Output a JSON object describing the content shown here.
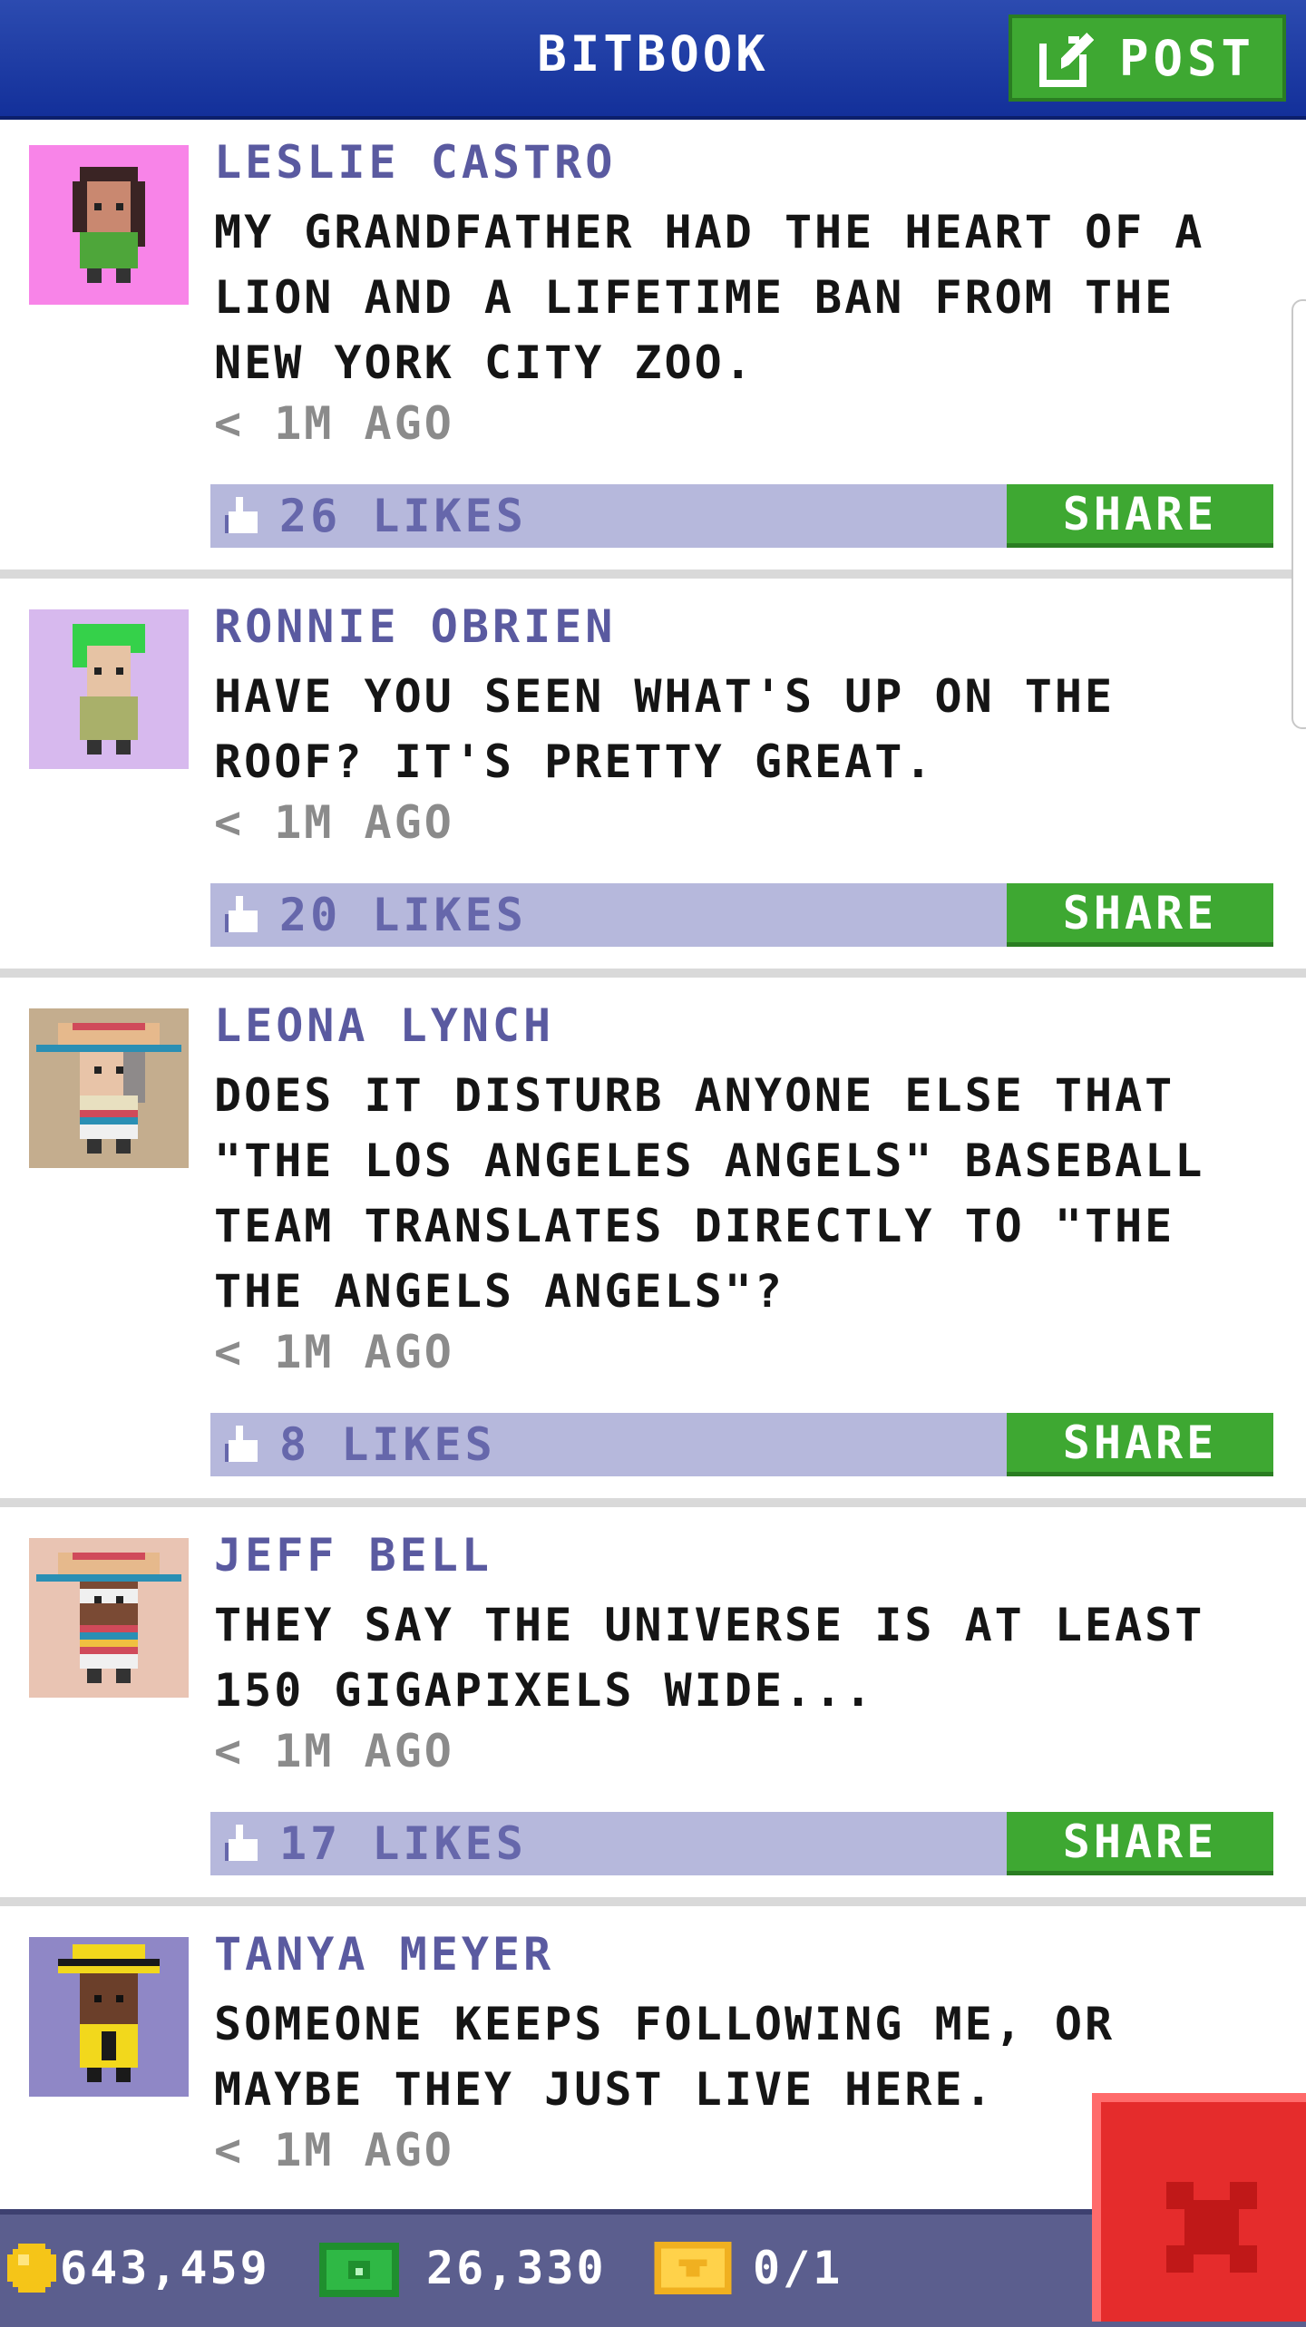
{
  "header": {
    "title": "BITBOOK",
    "post_label": "POST",
    "post_icon": "edit-icon"
  },
  "posts": [
    {
      "author": "LESLIE CASTRO",
      "body": "MY GRANDFATHER HAD THE HEART OF A LION AND A LIFETIME BAN FROM THE NEW YORK CITY ZOO.",
      "time": "< 1M AGO",
      "likes": "26 LIKES",
      "share": "SHARE",
      "avatar_bg": "#f884e8"
    },
    {
      "author": "RONNIE OBRIEN",
      "body": "HAVE YOU SEEN WHAT'S UP ON THE ROOF? IT'S PRETTY GREAT.",
      "time": "< 1M AGO",
      "likes": "20 LIKES",
      "share": "SHARE",
      "avatar_bg": "#d7b9ee"
    },
    {
      "author": "LEONA LYNCH",
      "body": "DOES IT DISTURB ANYONE ELSE THAT \"THE LOS ANGELES ANGELS\" BASEBALL TEAM TRANSLATES DIRECTLY TO \"THE THE ANGELS ANGELS\"?",
      "time": "< 1M AGO",
      "likes": "8 LIKES",
      "share": "SHARE",
      "avatar_bg": "#c4ad8e"
    },
    {
      "author": "JEFF BELL",
      "body": "THEY SAY THE UNIVERSE IS AT LEAST 150 GIGAPIXELS WIDE...",
      "time": "< 1M AGO",
      "likes": "17 LIKES",
      "share": "SHARE",
      "avatar_bg": "#e9c4b3"
    },
    {
      "author": "TANYA MEYER",
      "body": "SOMEONE KEEPS FOLLOWING ME, OR MAYBE THEY JUST LIVE HERE.",
      "time": "< 1M AGO",
      "avatar_bg": "#8f87c6"
    }
  ],
  "bottom_bar": {
    "coins": "643,459",
    "bux": "26,330",
    "tickets": "0/1"
  },
  "colors": {
    "header": "#1f3ea6",
    "accent_green": "#3ea832",
    "likes_bar": "#b6b8dc",
    "close_red": "#e52c2c"
  }
}
